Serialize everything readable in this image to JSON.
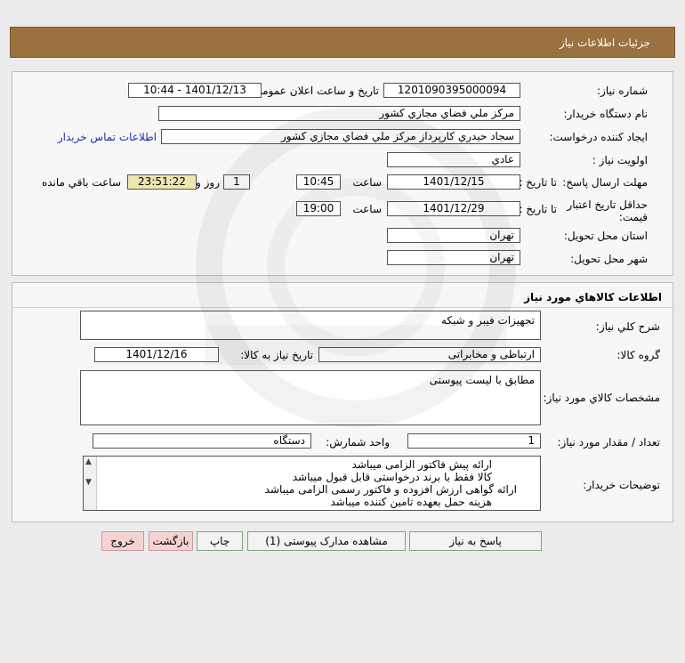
{
  "header": {
    "title": "جزئیات اطلاعات نیاز"
  },
  "info": {
    "need_number_label": "شماره نیاز:",
    "need_number": "1201090395000094",
    "announce_label": "تاریخ و ساعت اعلان عمومی:",
    "announce_value": "1401/12/13 - 10:44",
    "buyer_org_label": "نام دستگاه خریدار:",
    "buyer_org": "مرکز ملي فضاي مجازي کشور",
    "requester_label": "ایجاد کننده درخواست:",
    "requester": "سجاد حيدري کارپرداز مرکز ملي فضاي مجازي کشور",
    "contact_link": "اطلاعات تماس خریدار",
    "priority_label": "اولویت نیاز :",
    "priority": "عادي",
    "deadline_label": "مهلت ارسال پاسخ:",
    "until_date_label": "تا تاریخ :",
    "deadline_date": "1401/12/15",
    "time_label": "ساعت",
    "deadline_time": "10:45",
    "days_value": "1",
    "days_label": "روز و",
    "remaining_time": "23:51:22",
    "remaining_label": "ساعت باقي مانده",
    "validity_label": "حداقل تاریخ اعتبار قیمت:",
    "validity_until_label": "تا تاریخ :",
    "validity_date": "1401/12/29",
    "validity_time_label": "ساعت",
    "validity_time": "19:00",
    "province_label": "استان محل تحویل:",
    "province": "تهران",
    "city_label": "شهر محل تحویل:",
    "city": "تهران"
  },
  "goods": {
    "title": "اطلاعات کالاهاي مورد نياز",
    "summary_label": "شرح کلي نياز:",
    "summary": "تجهیزات فیبر و شبکه",
    "group_label": "گروه کالا:",
    "group": "ارتباطی و مخابراتی",
    "need_date_label": "تاریخ نیاز به کالا:",
    "need_date": "1401/12/16",
    "specs_label": "مشخصات کالاي مورد نياز:",
    "specs": "مطابق با لیست پیوستی",
    "qty_label": "تعداد / مقدار مورد نیاز:",
    "qty": "1",
    "unit_label": "واحد شمارش:",
    "unit": "دستگاه",
    "desc_label": "توضیحات خریدار:",
    "desc_lines": [
      "ارائه پیش فاکتور الزامی میباشد",
      "کالا فقط با برند درخواستی قابل قبول میباشد",
      "ارائه گواهی ارزش افزوده و فاکتور رسمی الزامی میباشد",
      "هزینه حمل بعهده تامین کننده میباشد"
    ]
  },
  "buttons": {
    "reply": "پاسخ به نیاز",
    "attachments": "مشاهده مدارک پیوستی (1)",
    "print": "چاپ",
    "back": "بازگشت",
    "exit": "خروج"
  },
  "colors": {
    "header": "#9a7240",
    "accent_link": "#1f2fae",
    "remaining_bg": "#efe6b0",
    "exit_bg": "#f6d3d3"
  }
}
